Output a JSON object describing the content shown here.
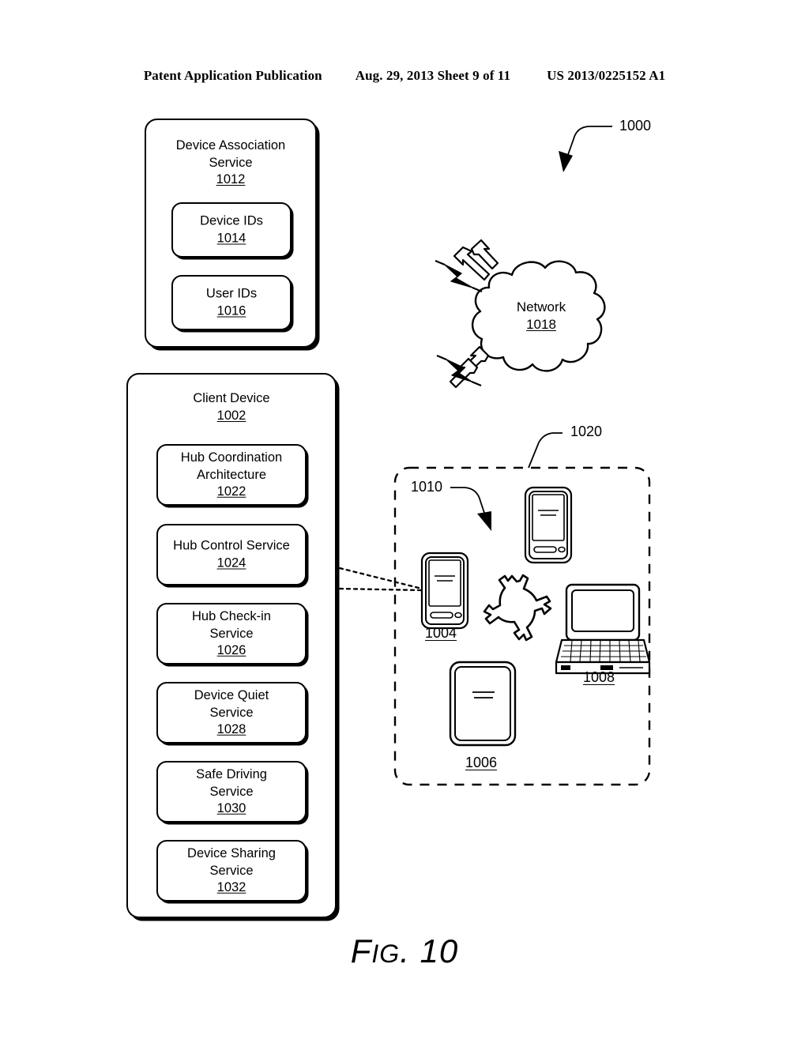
{
  "header": {
    "publication": "Patent Application Publication",
    "date_sheet": "Aug. 29, 2013  Sheet 9 of 11",
    "patent_number": "US 2013/0225152 A1"
  },
  "figure": {
    "caption_f": "F",
    "caption_ig": "IG",
    "caption_num": ". 10",
    "overall_ref": "1000"
  },
  "device_association_service": {
    "title_line1": "Device Association",
    "title_line2": "Service",
    "ref": "1012",
    "children": [
      {
        "label": "Device IDs",
        "ref": "1014"
      },
      {
        "label": "User IDs",
        "ref": "1016"
      }
    ]
  },
  "client_device": {
    "title": "Client Device",
    "ref": "1002",
    "services": [
      {
        "line1": "Hub Coordination",
        "line2": "Architecture",
        "ref": "1022"
      },
      {
        "line1": "Hub Control Service",
        "line2": "",
        "ref": "1024"
      },
      {
        "line1": "Hub Check-in",
        "line2": "Service",
        "ref": "1026"
      },
      {
        "line1": "Device Quiet",
        "line2": "Service",
        "ref": "1028"
      },
      {
        "line1": "Safe Driving",
        "line2": "Service",
        "ref": "1030"
      },
      {
        "line1": "Device Sharing",
        "line2": "Service",
        "ref": "1032"
      }
    ]
  },
  "network": {
    "label": "Network",
    "ref": "1018"
  },
  "device_group": {
    "group_ref": "1020",
    "pointer_ref": "1010",
    "devices": [
      {
        "name": "phone-1004",
        "ref": "1004"
      },
      {
        "name": "phone-1010",
        "ref": ""
      },
      {
        "name": "tablet-1006",
        "ref": "1006"
      },
      {
        "name": "laptop-1008",
        "ref": "1008"
      }
    ]
  },
  "colors": {
    "ink": "#000000",
    "paper": "#ffffff"
  }
}
